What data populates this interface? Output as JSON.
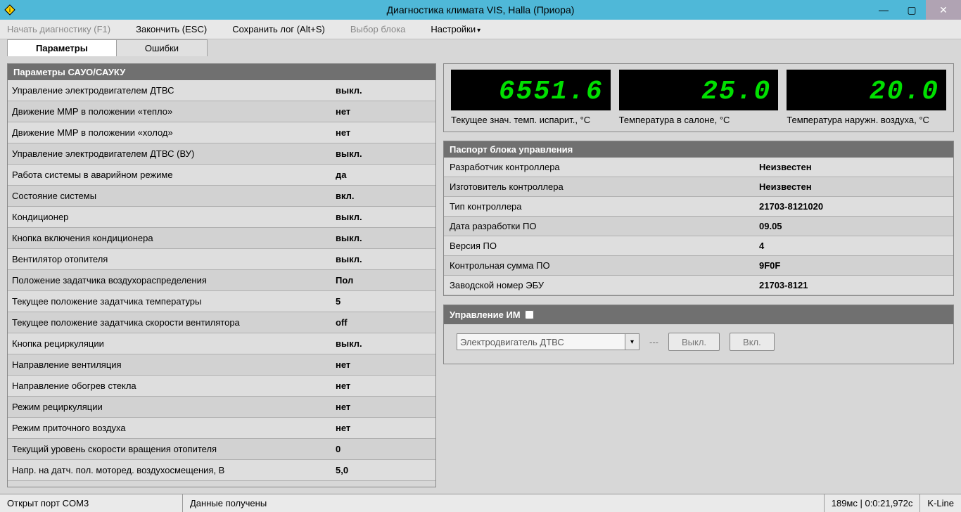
{
  "window": {
    "title": "Диагностика климата VIS, Halla (Приора)"
  },
  "menu": {
    "start": "Начать диагностику (F1)",
    "finish": "Закончить (ESC)",
    "savelog": "Сохранить лог (Alt+S)",
    "selectblock": "Выбор блока",
    "settings": "Настройки"
  },
  "tabs": {
    "params": "Параметры",
    "errors": "Ошибки"
  },
  "params_panel": {
    "header": "Параметры САУО/САУКУ",
    "rows": [
      {
        "name": "Управление электродвигателем ДТВС",
        "val": "выкл."
      },
      {
        "name": "Движение ММР в положении «тепло»",
        "val": "нет"
      },
      {
        "name": "Движение ММР в положении «холод»",
        "val": "нет"
      },
      {
        "name": "Управление электродвигателем ДТВС (ВУ)",
        "val": "выкл."
      },
      {
        "name": "Работа системы в аварийном режиме",
        "val": "да"
      },
      {
        "name": "Состояние системы",
        "val": "вкл."
      },
      {
        "name": "Кондиционер",
        "val": "выкл."
      },
      {
        "name": "Кнопка включения кондиционера",
        "val": "выкл."
      },
      {
        "name": "Вентилятор отопителя",
        "val": "выкл."
      },
      {
        "name": "Положение задатчика воздухораспределения",
        "val": "Пол"
      },
      {
        "name": "Текущее положение задатчика температуры",
        "val": "5"
      },
      {
        "name": "Текущее положение задатчика скорости вентилятора",
        "val": "off"
      },
      {
        "name": "Кнопка рециркуляции",
        "val": "выкл."
      },
      {
        "name": "Направление вентиляция",
        "val": "нет"
      },
      {
        "name": "Направление обогрев стекла",
        "val": "нет"
      },
      {
        "name": "Режим рециркуляции",
        "val": "нет"
      },
      {
        "name": "Режим приточного воздуха",
        "val": "нет"
      },
      {
        "name": "Текущий уровень скорости вращения отопителя",
        "val": "0"
      },
      {
        "name": "Напр. на датч. пол. моторед. воздухосмещения, В",
        "val": "5,0"
      }
    ]
  },
  "leds": [
    {
      "value": "6551.6",
      "label": "Текущее знач. темп. испарит., °C"
    },
    {
      "value": "25.0",
      "label": "Температура в салоне, °C"
    },
    {
      "value": "20.0",
      "label": "Температура наружн. воздуха, °C"
    }
  ],
  "passport": {
    "header": "Паспорт блока управления",
    "rows": [
      {
        "name": "Разработчик контроллера",
        "val": "Неизвестен"
      },
      {
        "name": "Изготовитель контроллера",
        "val": "Неизвестен"
      },
      {
        "name": "Тип контроллера",
        "val": "21703-8121020"
      },
      {
        "name": "Дата разработки ПО",
        "val": "09.05"
      },
      {
        "name": "Версия ПО",
        "val": "4"
      },
      {
        "name": "Контрольная сумма ПО",
        "val": "9F0F"
      },
      {
        "name": "Заводской номер ЭБУ",
        "val": "21703-8121"
      }
    ]
  },
  "control_im": {
    "header": "Управление ИМ",
    "combo_value": "Электродвигатель ДТВС",
    "dash": "---",
    "btn_off": "Выкл.",
    "btn_on": "Вкл."
  },
  "statusbar": {
    "port": "Открыт порт COM3",
    "data": "Данные получены",
    "timing": "189мс | 0:0:21,972с",
    "proto": "K-Line"
  }
}
